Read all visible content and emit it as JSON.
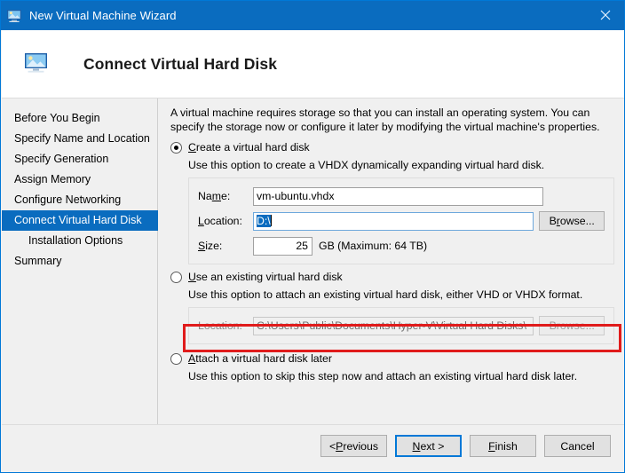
{
  "window": {
    "title": "New Virtual Machine Wizard",
    "icon": "virtual-machine-icon",
    "close_icon": "close-icon",
    "accent_color": "#0a6cbf",
    "highlight_color": "#e01b1b"
  },
  "header": {
    "icon": "virtual-hard-disk-icon",
    "title": "Connect Virtual Hard Disk"
  },
  "sidebar": {
    "items": [
      {
        "label": "Before You Begin",
        "selected": false,
        "indented": false
      },
      {
        "label": "Specify Name and Location",
        "selected": false,
        "indented": false
      },
      {
        "label": "Specify Generation",
        "selected": false,
        "indented": false
      },
      {
        "label": "Assign Memory",
        "selected": false,
        "indented": false
      },
      {
        "label": "Configure Networking",
        "selected": false,
        "indented": false
      },
      {
        "label": "Connect Virtual Hard Disk",
        "selected": true,
        "indented": false
      },
      {
        "label": "Installation Options",
        "selected": false,
        "indented": true
      },
      {
        "label": "Summary",
        "selected": false,
        "indented": false
      }
    ]
  },
  "main": {
    "intro": "A virtual machine requires storage so that you can install an operating system. You can specify the storage now or configure it later by modifying the virtual machine's properties.",
    "options": [
      {
        "label_pre": "",
        "label_accel": "C",
        "label_post": "reate a virtual hard disk",
        "full_label": "Create a virtual hard disk",
        "selected": true,
        "description": "Use this option to create a VHDX dynamically expanding virtual hard disk."
      },
      {
        "label_pre": "",
        "label_accel": "U",
        "label_post": "se an existing virtual hard disk",
        "full_label": "Use an existing virtual hard disk",
        "selected": false,
        "description": "Use this option to attach an existing virtual hard disk, either VHD or VHDX format."
      },
      {
        "label_pre": "",
        "label_accel": "A",
        "label_post": "ttach a virtual hard disk later",
        "full_label": "Attach a virtual hard disk later",
        "selected": false,
        "description": "Use this option to skip this step now and attach an existing virtual hard disk later."
      }
    ],
    "create_fields": {
      "name_label_pre": "Na",
      "name_label_accel": "m",
      "name_label_post": "e:",
      "name_value": "vm-ubuntu.vhdx",
      "location_label_pre": "",
      "location_label_accel": "L",
      "location_label_post": "ocation:",
      "location_value": "D:\\",
      "location_selected_text": "D:\\",
      "browse_label_pre": "B",
      "browse_label_accel": "r",
      "browse_label_post": "owse...",
      "browse_full": "Browse...",
      "size_label_pre": "",
      "size_label_accel": "S",
      "size_label_post": "ize:",
      "size_value": "25",
      "size_units": "GB (Maximum: 64 TB)"
    },
    "existing_fields": {
      "location_label": "Location:",
      "location_value": "C:\\Users\\Public\\Documents\\Hyper-V\\Virtual Hard Disks\\",
      "browse_label": "Browse..."
    }
  },
  "footer": {
    "buttons": [
      {
        "pre": "< ",
        "accel": "P",
        "post": "revious",
        "full": "< Previous",
        "default": false
      },
      {
        "pre": "",
        "accel": "N",
        "post": "ext >",
        "full": "Next >",
        "default": true
      },
      {
        "pre": "",
        "accel": "F",
        "post": "inish",
        "full": "Finish",
        "default": false
      },
      {
        "pre": "",
        "accel": "",
        "post": "Cancel",
        "full": "Cancel",
        "default": false
      }
    ]
  }
}
